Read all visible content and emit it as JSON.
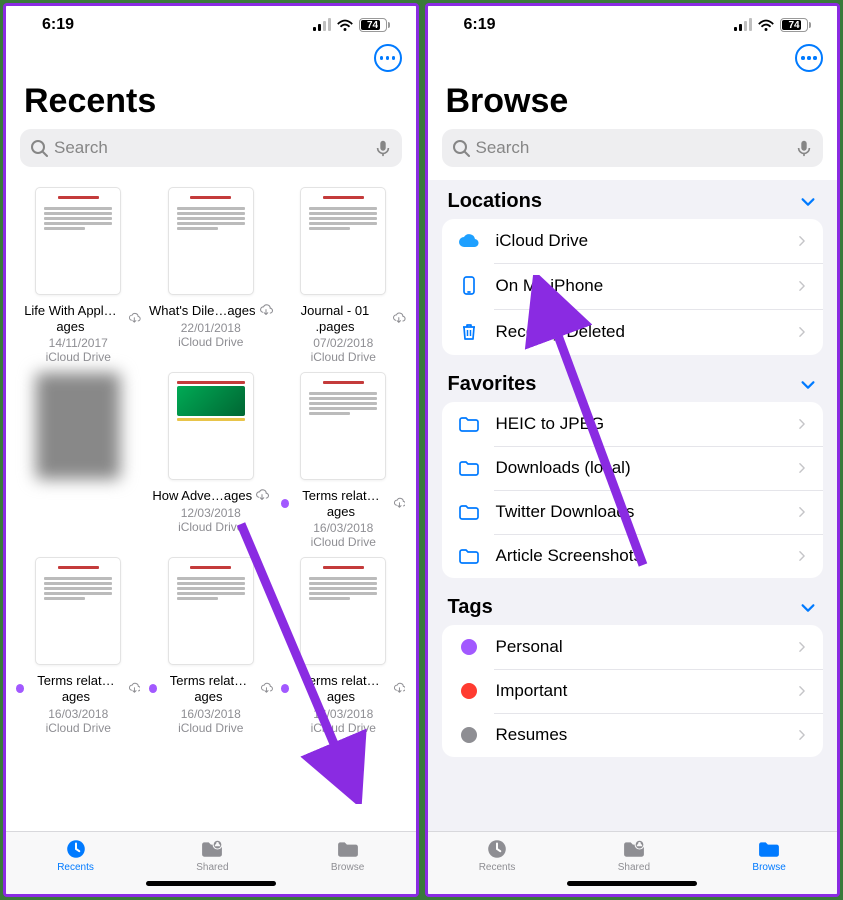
{
  "status": {
    "time": "6:19",
    "battery": "74"
  },
  "search": {
    "placeholder": "Search"
  },
  "left": {
    "title": "Recents",
    "files": [
      {
        "name": "Life With Appl…ages",
        "date": "14/11/2017",
        "loc": "iCloud Drive",
        "tag": false,
        "style": "doc"
      },
      {
        "name": "What's Dile…ages",
        "date": "22/01/2018",
        "loc": "iCloud Drive",
        "tag": false,
        "style": "doc"
      },
      {
        "name": "Journal - 01 .pages",
        "date": "07/02/2018",
        "loc": "iCloud Drive",
        "tag": false,
        "style": "doc"
      },
      {
        "name": "",
        "date": "",
        "loc": "",
        "tag": false,
        "style": "blur"
      },
      {
        "name": "How Adve…ages",
        "date": "12/03/2018",
        "loc": "iCloud Drive",
        "tag": false,
        "style": "img"
      },
      {
        "name": "Terms relat…ages",
        "date": "16/03/2018",
        "loc": "iCloud Drive",
        "tag": true,
        "style": "doc"
      },
      {
        "name": "Terms relat…ages",
        "date": "16/03/2018",
        "loc": "iCloud Drive",
        "tag": true,
        "style": "doc"
      },
      {
        "name": "Terms relat…ages",
        "date": "16/03/2018",
        "loc": "iCloud Drive",
        "tag": true,
        "style": "doc"
      },
      {
        "name": "Terms relat…ages",
        "date": "16/03/2018",
        "loc": "iCloud Drive",
        "tag": true,
        "style": "doc"
      }
    ],
    "tabs": {
      "recents": "Recents",
      "shared": "Shared",
      "browse": "Browse"
    }
  },
  "right": {
    "title": "Browse",
    "sections": {
      "locations": {
        "header": "Locations",
        "items": [
          {
            "icon": "cloud",
            "label": "iCloud Drive"
          },
          {
            "icon": "iphone",
            "label": "On My iPhone"
          },
          {
            "icon": "trash",
            "label": "Recently Deleted"
          }
        ]
      },
      "favorites": {
        "header": "Favorites",
        "items": [
          {
            "icon": "folder",
            "label": "HEIC to JPEG"
          },
          {
            "icon": "folder",
            "label": "Downloads (local)"
          },
          {
            "icon": "folder",
            "label": "Twitter Downloads"
          },
          {
            "icon": "folder",
            "label": "Article Screenshots"
          }
        ]
      },
      "tags": {
        "header": "Tags",
        "items": [
          {
            "color": "#a259ff",
            "label": "Personal"
          },
          {
            "color": "#ff3b30",
            "label": "Important"
          },
          {
            "color": "#8e8e93",
            "label": "Resumes"
          }
        ]
      }
    },
    "tabs": {
      "recents": "Recents",
      "shared": "Shared",
      "browse": "Browse"
    }
  }
}
